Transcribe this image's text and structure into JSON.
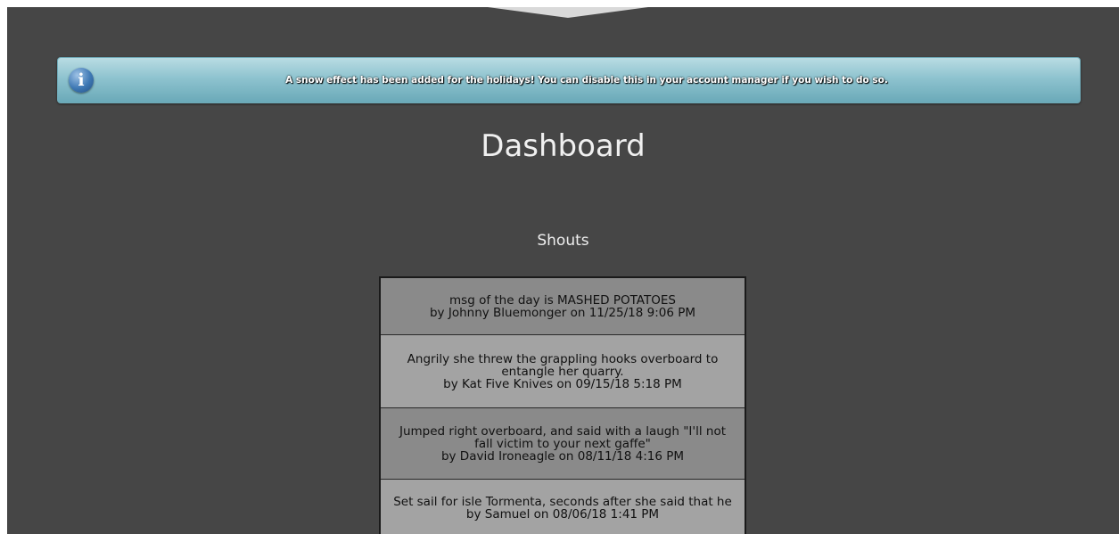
{
  "notice": {
    "icon": "info-icon",
    "icon_glyph": "i",
    "text": "A snow effect has been added for the holidays! You can disable this in your account manager if you wish to do so."
  },
  "page": {
    "title": "Dashboard"
  },
  "shouts": {
    "heading": "Shouts",
    "items": [
      {
        "message": "msg of the day is MASHED POTATOES",
        "byline": "by Johnny Bluemonger on 11/25/18 9:06 PM"
      },
      {
        "message": "Angrily she threw the grappling hooks overboard to entangle her quarry.",
        "byline": "by Kat Five Knives on 09/15/18 5:18 PM"
      },
      {
        "message": "Jumped right overboard, and said with a laugh \"I'll not fall victim to your next gaffe\"",
        "byline": "by David Ironeagle on 08/11/18 4:16 PM"
      },
      {
        "message": "Set sail for isle Tormenta, seconds after she said that he",
        "byline": "by Samuel on 08/06/18 1:41 PM"
      }
    ]
  },
  "colors": {
    "background": "#464646",
    "notice_accent": "#8ec3cf",
    "shout_dark": "#8a8a8a",
    "shout_light": "#a3a3a3"
  }
}
